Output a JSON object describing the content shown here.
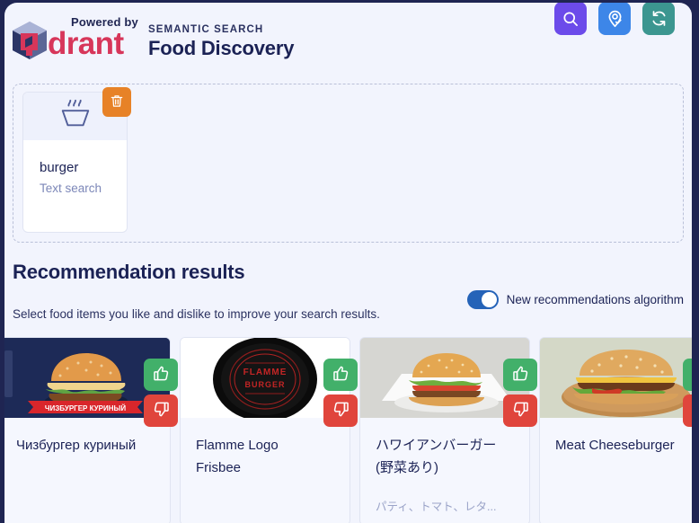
{
  "page": {
    "background_color": "#1f2552",
    "panel_color": "#f2f4fd"
  },
  "header": {
    "powered_by": "Powered by",
    "brand": "drant",
    "eyebrow": "SEMANTIC SEARCH",
    "title": "Food Discovery",
    "actions": [
      {
        "name": "search-button",
        "icon": "search-icon",
        "color": "#6c4bea"
      },
      {
        "name": "location-button",
        "icon": "location-pin-check-icon",
        "color": "#3d86e8"
      },
      {
        "name": "refresh-button",
        "icon": "refresh-icon",
        "color": "#3c9690"
      }
    ]
  },
  "search_context": {
    "cards": [
      {
        "title": "burger",
        "subtitle": "Text search",
        "icon": "bowl-steam-icon",
        "delete_icon": "trash-icon",
        "delete_color": "#e78227"
      }
    ]
  },
  "results": {
    "title": "Recommendation results",
    "subtitle": "Select food items you like and dislike to improve your search results.",
    "toggle": {
      "label": "New recommendations algorithm",
      "on": true,
      "on_color": "#2563b8"
    },
    "vote": {
      "like_icon": "thumbs-up-icon",
      "dislike_icon": "thumbs-down-icon",
      "like_color": "#42b06a",
      "dislike_color": "#e0453c"
    },
    "cards": [
      {
        "title": "Чизбургер куриный",
        "subtitle": "",
        "image": "chicken-cheeseburger-photo",
        "image_banner": "ЧИЗБУРГЕР КУРИНЫЙ",
        "image_bg": "#1d2a57"
      },
      {
        "title": "Flamme Logo Frisbee",
        "subtitle": "",
        "image": "flamme-burger-frisbee-photo",
        "image_banner": "FLAMME BURGER",
        "image_bg": "#ffffff"
      },
      {
        "title": "ハワイアンバーガー (野菜あり)",
        "subtitle": "パティ、トマト、レタ...",
        "image": "hawaiian-burger-photo",
        "image_banner": "",
        "image_bg": "#d9d9d6"
      },
      {
        "title": "Meat Cheeseburger",
        "subtitle": "",
        "image": "meat-cheeseburger-photo",
        "image_banner": "",
        "image_bg": "#cfd3c4"
      }
    ]
  }
}
